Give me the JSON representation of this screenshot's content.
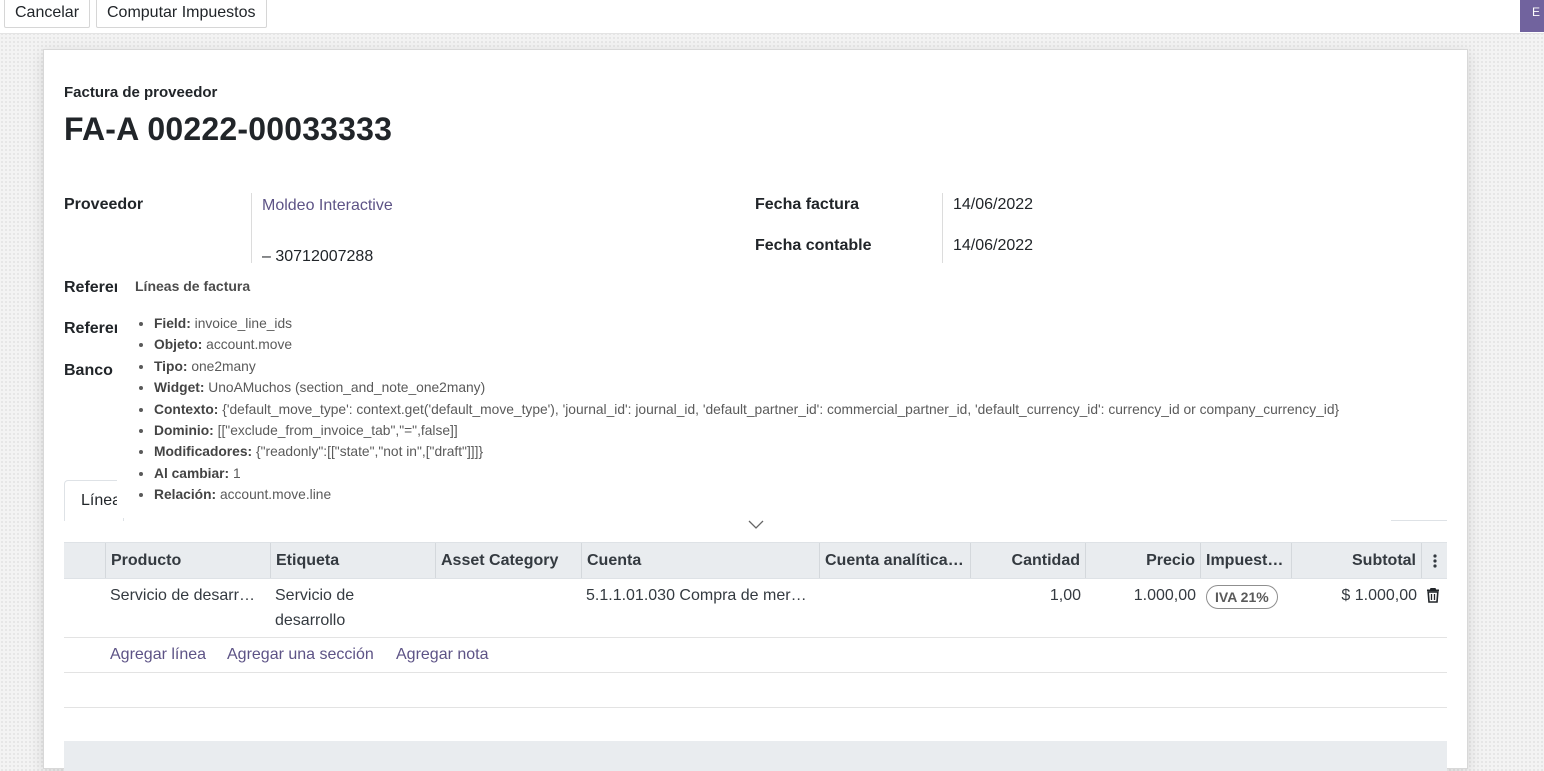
{
  "controlbar": {
    "cancel_label": "Cancelar",
    "compute_taxes_label": "Computar Impuestos",
    "primary_label": "E"
  },
  "invoice": {
    "type_label": "Factura de proveedor",
    "number": "FA-A 00222-00033333",
    "supplier_label": "Proveedor",
    "supplier_name": "Moldeo Interactive",
    "supplier_vat": "– 30712007288",
    "invoice_date_label": "Fecha factura",
    "invoice_date": "14/06/2022",
    "accounting_date_label": "Fecha contable",
    "accounting_date": "14/06/2022",
    "reference_label_1": "Referen",
    "reference_label_2": "Referen",
    "bank_label": "Banco"
  },
  "tooltip": {
    "title": "Líneas de factura",
    "items": [
      {
        "key": "Field:",
        "value": "invoice_line_ids"
      },
      {
        "key": "Objeto:",
        "value": "account.move"
      },
      {
        "key": "Tipo:",
        "value": "one2many"
      },
      {
        "key": "Widget:",
        "value": "UnoAMuchos (section_and_note_one2many)"
      },
      {
        "key": "Contexto:",
        "value": "{'default_move_type': context.get('default_move_type'), 'journal_id': journal_id, 'default_partner_id': commercial_partner_id, 'default_currency_id': currency_id or company_currency_id}"
      },
      {
        "key": "Dominio:",
        "value": "[[\"exclude_from_invoice_tab\",\"=\",false]]"
      },
      {
        "key": "Modificadores:",
        "value": "{\"readonly\":[[\"state\",\"not in\",[\"draft\"]]]}"
      },
      {
        "key": "Al cambiar:",
        "value": "1"
      },
      {
        "key": "Relación:",
        "value": "account.move.line"
      }
    ]
  },
  "tabs": {
    "invoice_lines": "Línea"
  },
  "table": {
    "headers": {
      "product": "Producto",
      "label": "Etiqueta",
      "asset_category": "Asset Category",
      "account": "Cuenta",
      "analytic_account": "Cuenta analítica…",
      "quantity": "Cantidad",
      "price": "Precio",
      "taxes": "Impuest…",
      "subtotal": "Subtotal"
    },
    "rows": [
      {
        "product": "Servicio de desarr…",
        "label_line1": "Servicio de",
        "label_line2": "desarrollo",
        "asset_category": "",
        "account": "5.1.1.01.030 Compra de mer…",
        "analytic_account": "",
        "quantity": "1,00",
        "price": "1.000,00",
        "tax": "IVA 21%",
        "subtotal": "$ 1.000,00"
      }
    ],
    "add_line": "Agregar línea",
    "add_section": "Agregar una sección",
    "add_note": "Agregar nota"
  }
}
